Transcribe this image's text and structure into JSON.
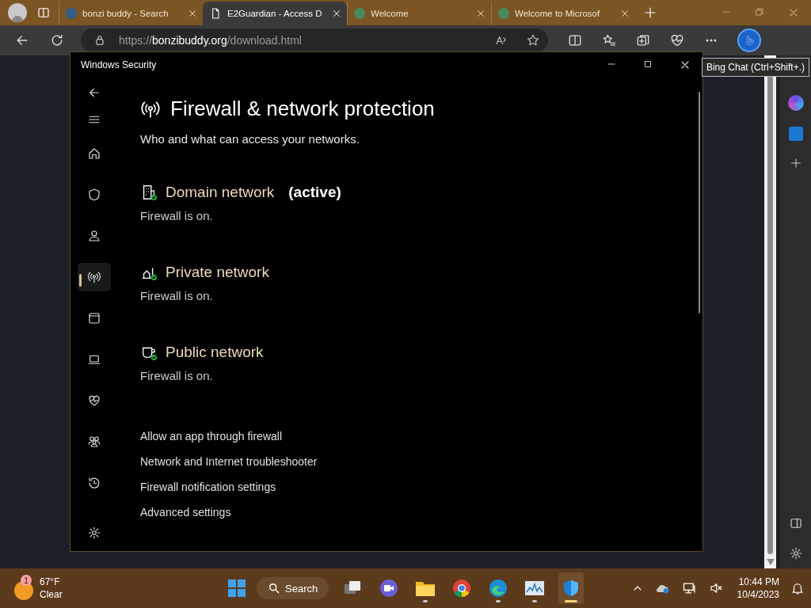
{
  "browser": {
    "tabs": [
      {
        "label": "bonzi buddy - Search",
        "selected": false
      },
      {
        "label": "E2Guardian - Access D",
        "selected": true
      },
      {
        "label": "Welcome",
        "selected": false
      },
      {
        "label": "Welcome to Microsof",
        "selected": false
      }
    ],
    "address": {
      "scheme": "https://",
      "domain": "bonzibuddy.org",
      "path": "/download.html"
    },
    "tooltip": "Bing Chat (Ctrl+Shift+.)"
  },
  "security_window": {
    "title": "Windows Security",
    "nav": [
      {
        "selected": false
      },
      {
        "selected": false
      },
      {
        "selected": false
      },
      {
        "selected": true
      },
      {
        "selected": false
      },
      {
        "selected": false
      },
      {
        "selected": false
      },
      {
        "selected": false
      },
      {
        "selected": false
      }
    ],
    "heading": "Firewall & network protection",
    "subtitle": "Who and what can access your networks.",
    "networks": [
      {
        "name": "Domain network",
        "active_label": "(active)",
        "status": "Firewall is on."
      },
      {
        "name": "Private network",
        "status": "Firewall is on."
      },
      {
        "name": "Public network",
        "status": "Firewall is on."
      }
    ],
    "links": [
      "Allow an app through firewall",
      "Network and Internet troubleshooter",
      "Firewall notification settings",
      "Advanced settings"
    ]
  },
  "taskbar": {
    "weather": {
      "badge": "1",
      "temperature": "67°F",
      "condition": "Clear"
    },
    "search": "Search",
    "apps": [
      {
        "running": false,
        "selected": false
      },
      {
        "running": false,
        "selected": false
      },
      {
        "running": true,
        "selected": false
      },
      {
        "running": false,
        "selected": false
      },
      {
        "running": true,
        "selected": false
      },
      {
        "running": true,
        "selected": false
      },
      {
        "running": true,
        "selected": true
      }
    ],
    "time": "10:44 PM",
    "date": "10/4/2023"
  }
}
